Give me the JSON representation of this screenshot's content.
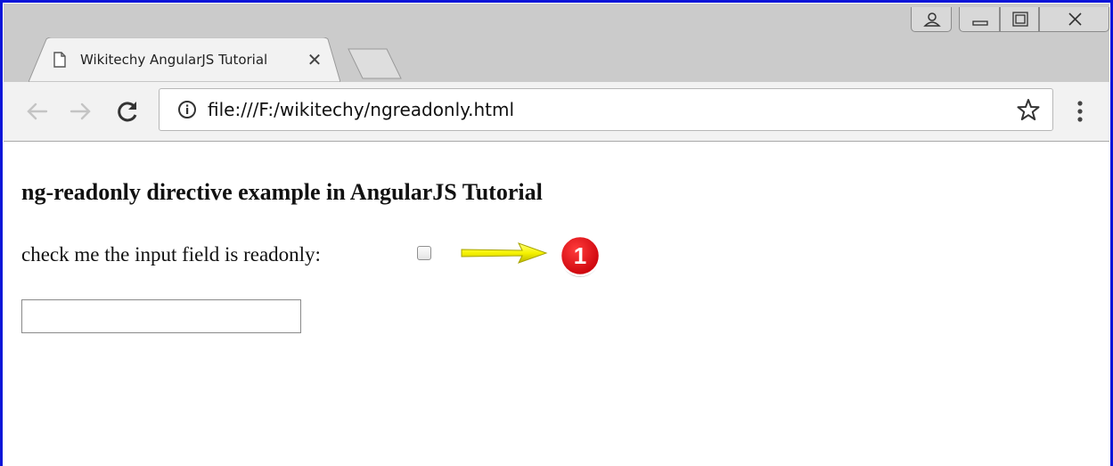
{
  "browser": {
    "tab": {
      "title": "Wikitechy AngularJS Tutorial",
      "favicon": "document-icon"
    },
    "address_bar": {
      "url": "file:///F:/wikitechy/ngreadonly.html"
    },
    "icons": [
      "back-icon",
      "forward-icon",
      "reload-icon",
      "info-icon",
      "star-icon",
      "menu-icon",
      "profile-icon",
      "minimize-icon",
      "maximize-icon",
      "close-icon"
    ]
  },
  "page": {
    "heading": "ng-readonly directive example in AngularJS Tutorial",
    "checkbox_label": "check me the input field is readonly:",
    "checkbox_checked": false,
    "input_value": ""
  },
  "annotation": {
    "badge_number": "1",
    "badge_color": "#e4000e",
    "arrow_color": "#f6f300"
  },
  "colors": {
    "frame": "#0a15d8",
    "tabstrip": "#cbcbcb",
    "toolbar": "#f2f2f2"
  }
}
